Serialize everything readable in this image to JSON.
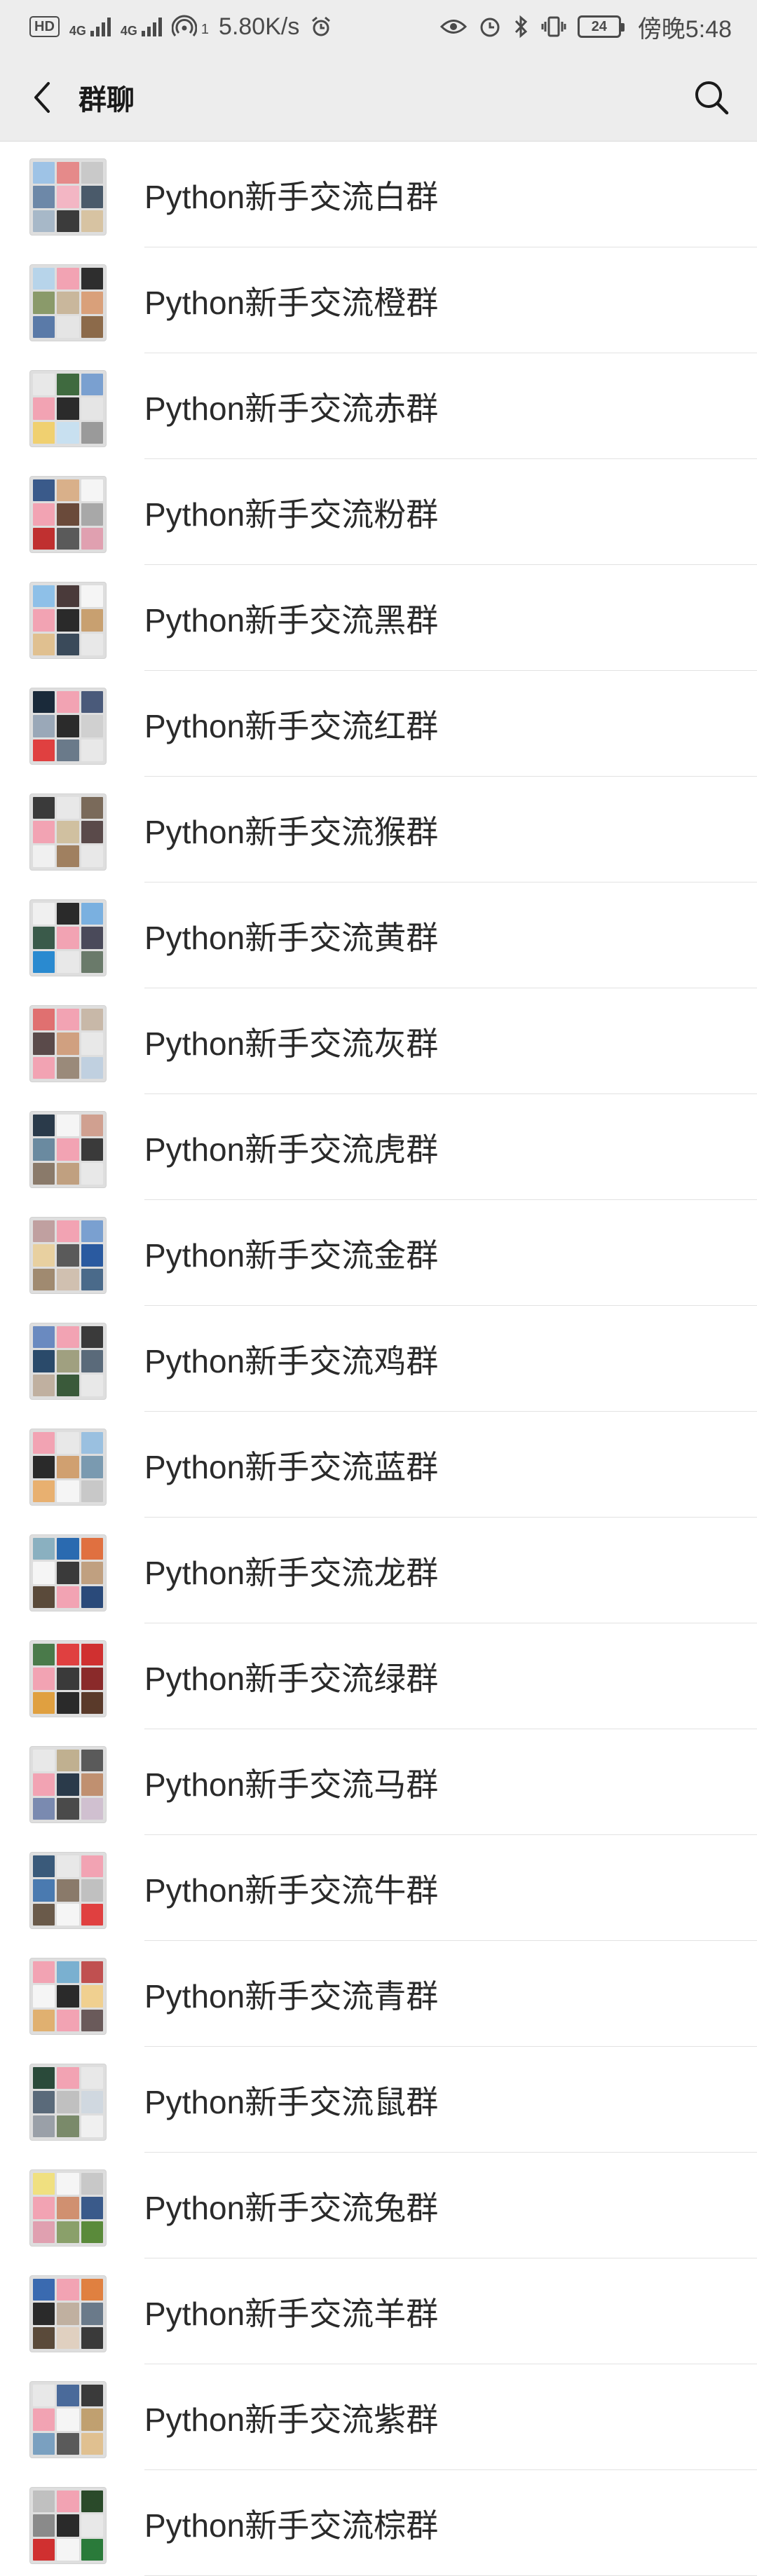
{
  "status_bar": {
    "hd": "HD",
    "net_1": "4G",
    "net_2": "4G",
    "hotspot_count": "1",
    "speed": "5.80K/s",
    "battery": "24",
    "time": "傍晚5:48"
  },
  "header": {
    "title": "群聊"
  },
  "groups": [
    {
      "name": "Python新手交流白群",
      "tiles": [
        "#9ec3e6",
        "#e58a8a",
        "#c9c9c9",
        "#6d88a8",
        "#f3b6c4",
        "#4a5a6a",
        "#a7b8c8",
        "#3b3b3b",
        "#d7c3a2"
      ]
    },
    {
      "name": "Python新手交流橙群",
      "tiles": [
        "#b7d4ea",
        "#f2a3b3",
        "#2e2e2e",
        "#8a9a6a",
        "#c9b79c",
        "#d9a07a",
        "#5a7aa8",
        "#e5e5e5",
        "#8c6a4a"
      ]
    },
    {
      "name": "Python新手交流赤群",
      "tiles": [
        "#e8e8e8",
        "#3f6a3f",
        "#7aa0d0",
        "#f2a3b3",
        "#2b2b2b",
        "#e5e5e5",
        "#f0d070",
        "#c8e0f0",
        "#9a9a9a"
      ]
    },
    {
      "name": "Python新手交流粉群",
      "tiles": [
        "#3a5a8a",
        "#d9b08a",
        "#f5f5f5",
        "#f2a3b3",
        "#6a4a3a",
        "#a8a8a8",
        "#c03030",
        "#5a5a5a",
        "#e0a0b0"
      ]
    },
    {
      "name": "Python新手交流黑群",
      "tiles": [
        "#8ec0e8",
        "#4a3a3a",
        "#f5f5f5",
        "#f2a3b3",
        "#2a2a2a",
        "#c8a070",
        "#e0c090",
        "#3a4a5a",
        "#e8e8e8"
      ]
    },
    {
      "name": "Python新手交流红群",
      "tiles": [
        "#1a2a3a",
        "#f2a3b3",
        "#4a5a7a",
        "#9aa8b8",
        "#2b2b2b",
        "#d0d0d0",
        "#e04040",
        "#6a7a8a",
        "#e8e8e8"
      ]
    },
    {
      "name": "Python新手交流猴群",
      "tiles": [
        "#3a3a3a",
        "#e8e8e8",
        "#7a6a5a",
        "#f2a3b3",
        "#d0c0a0",
        "#5a4a4a",
        "#f0f0f0",
        "#a08060",
        "#e8e8e8"
      ]
    },
    {
      "name": "Python新手交流黄群",
      "tiles": [
        "#f0f0f0",
        "#2a2a2a",
        "#7ab0e0",
        "#3a5a4a",
        "#f2a3b3",
        "#4a4a5a",
        "#2a8ad0",
        "#e8e8e8",
        "#6a7a6a"
      ]
    },
    {
      "name": "Python新手交流灰群",
      "tiles": [
        "#e07070",
        "#f2a3b3",
        "#c8b8a8",
        "#5a4a4a",
        "#d0a080",
        "#e8e8e8",
        "#f2a3b3",
        "#9a8a7a",
        "#c0d0e0"
      ]
    },
    {
      "name": "Python新手交流虎群",
      "tiles": [
        "#2a3a4a",
        "#f5f5f5",
        "#d0a090",
        "#6a8aa0",
        "#f2a3b3",
        "#3a3a3a",
        "#8a7a6a",
        "#c0a080",
        "#e8e8e8"
      ]
    },
    {
      "name": "Python新手交流金群",
      "tiles": [
        "#c0a0a0",
        "#f2a3b3",
        "#7aa0d0",
        "#e8d0a0",
        "#5a5a5a",
        "#2a5aa0",
        "#a08a70",
        "#d0c0b0",
        "#4a6a8a"
      ]
    },
    {
      "name": "Python新手交流鸡群",
      "tiles": [
        "#6a8ac0",
        "#f2a3b3",
        "#3a3a3a",
        "#2a4a6a",
        "#a0a080",
        "#5a6a7a",
        "#c0b0a0",
        "#3a5a3a",
        "#e8e8e8"
      ]
    },
    {
      "name": "Python新手交流蓝群",
      "tiles": [
        "#f2a3b3",
        "#e8e8e8",
        "#9ac0e0",
        "#2a2a2a",
        "#d0a070",
        "#7a9ab0",
        "#e8b070",
        "#f5f5f5",
        "#c8c8c8"
      ]
    },
    {
      "name": "Python新手交流龙群",
      "tiles": [
        "#8ab0c0",
        "#2a6ab0",
        "#e07040",
        "#f5f5f5",
        "#3a3a3a",
        "#c0a080",
        "#5a4a3a",
        "#f2a3b3",
        "#2a4a7a"
      ]
    },
    {
      "name": "Python新手交流绿群",
      "tiles": [
        "#4a7a4a",
        "#e04040",
        "#d03030",
        "#f2a3b3",
        "#3a3a3a",
        "#8a2a2a",
        "#e0a040",
        "#2a2a2a",
        "#5a3a2a"
      ]
    },
    {
      "name": "Python新手交流马群",
      "tiles": [
        "#e8e8e8",
        "#c0b090",
        "#5a5a5a",
        "#f2a3b3",
        "#2a3a4a",
        "#c09070",
        "#7a8ab0",
        "#4a4a4a",
        "#d0c0d0"
      ]
    },
    {
      "name": "Python新手交流牛群",
      "tiles": [
        "#3a5a7a",
        "#e8e8e8",
        "#f2a3b3",
        "#4a7ab0",
        "#8a7a6a",
        "#c0c0c0",
        "#6a5a4a",
        "#f5f5f5",
        "#e04040"
      ]
    },
    {
      "name": "Python新手交流青群",
      "tiles": [
        "#f2a3b3",
        "#7ab0d0",
        "#c05050",
        "#f5f5f5",
        "#2a2a2a",
        "#f0d090",
        "#e0b070",
        "#f2a3b3",
        "#6a5a5a"
      ]
    },
    {
      "name": "Python新手交流鼠群",
      "tiles": [
        "#2a4a3a",
        "#f2a3b3",
        "#e8e8e8",
        "#5a6a7a",
        "#c0c0c0",
        "#d0d8e0",
        "#9aa0a8",
        "#7a8a6a",
        "#f0f0f0"
      ]
    },
    {
      "name": "Python新手交流兔群",
      "tiles": [
        "#f0e080",
        "#f5f5f5",
        "#c8c8c8",
        "#f2a3b3",
        "#d09070",
        "#3a5a8a",
        "#e0a0b0",
        "#8aa06a",
        "#5a8a3a"
      ]
    },
    {
      "name": "Python新手交流羊群",
      "tiles": [
        "#3a6ab0",
        "#f2a3b3",
        "#e08040",
        "#2a2a2a",
        "#c0b0a0",
        "#6a7a8a",
        "#5a4a3a",
        "#e0d0c0",
        "#3a3a3a"
      ]
    },
    {
      "name": "Python新手交流紫群",
      "tiles": [
        "#e8e8e8",
        "#4a6a9a",
        "#3a3a3a",
        "#f2a3b3",
        "#f5f5f5",
        "#c0a070",
        "#7aa0c0",
        "#5a5a5a",
        "#e0c090"
      ]
    },
    {
      "name": "Python新手交流棕群",
      "tiles": [
        "#c0c0c0",
        "#f2a3b3",
        "#2a4a2a",
        "#8a8a8a",
        "#2a2a2a",
        "#e8e8e8",
        "#d03030",
        "#f5f5f5",
        "#2a7a3a"
      ]
    }
  ]
}
